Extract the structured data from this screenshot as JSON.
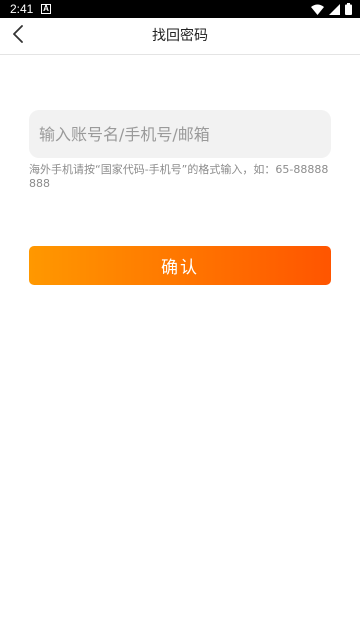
{
  "status_bar": {
    "time": "2:41",
    "notification_icon": "a-badge-icon",
    "icons": [
      "wifi-icon",
      "signal-icon",
      "battery-icon"
    ]
  },
  "header": {
    "title": "找回密码",
    "back_icon": "chevron-left-icon"
  },
  "form": {
    "account_placeholder": "输入账号名/手机号/邮箱",
    "account_value": "",
    "hint": "海外手机请按“国家代码-手机号”的格式输入，如：65-88888888",
    "confirm_label": "确认"
  },
  "colors": {
    "accent_start": "#ff9800",
    "accent_end": "#ff5500",
    "input_bg": "#f2f2f2",
    "hint_text": "#8c8c8c"
  }
}
